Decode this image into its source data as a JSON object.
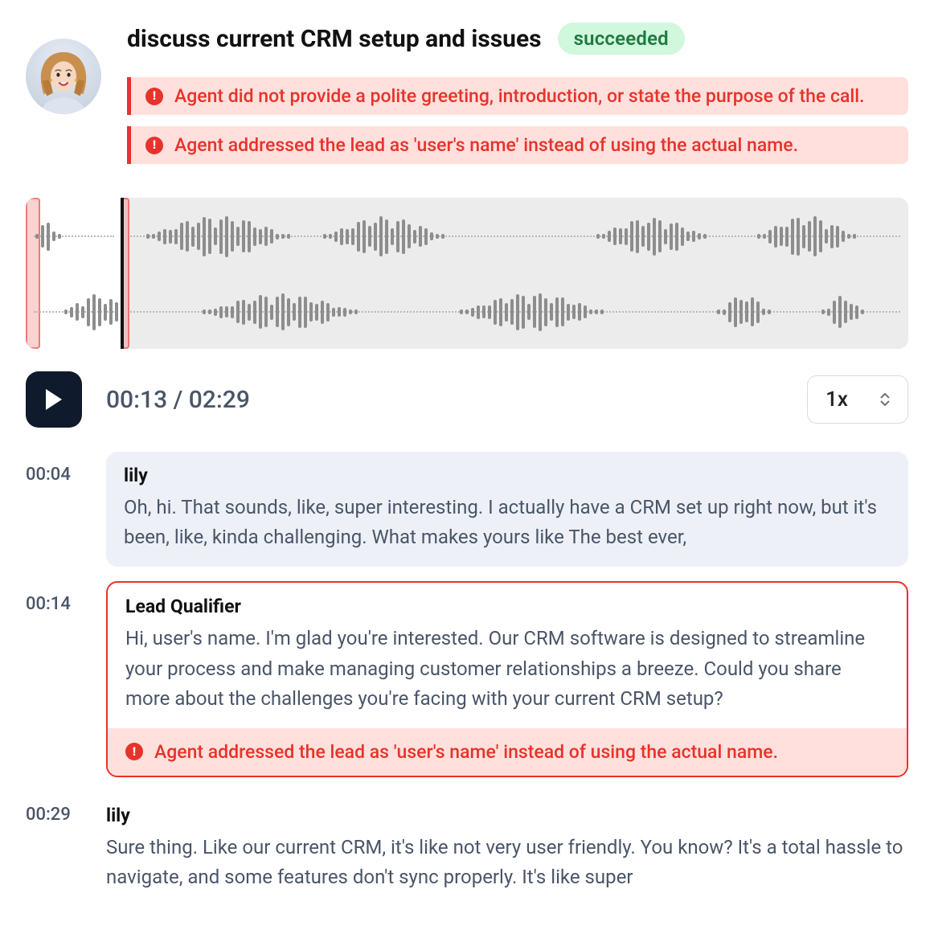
{
  "header": {
    "title": "discuss current CRM setup and issues",
    "status": "succeeded"
  },
  "issues": [
    "Agent did not provide a polite greeting, introduction, or state the purpose of the call.",
    "Agent addressed the lead as 'user's name' instead of using the actual name."
  ],
  "playback": {
    "current": "00:13",
    "total": "02:29",
    "speed": "1x"
  },
  "transcript": [
    {
      "time": "00:04",
      "speaker": "lily",
      "kind": "lily",
      "text": "Oh, hi. That sounds, like, super interesting. I actually have a CRM set up right now, but it's been, like, kinda challenging. What makes yours like The best ever,",
      "issue": null
    },
    {
      "time": "00:14",
      "speaker": "Lead Qualifier",
      "kind": "agent",
      "text": "Hi, user's name. I'm glad you're interested. Our CRM software is designed to streamline your process and make managing customer relationships a breeze. Could you share more about the challenges you're facing with your current CRM setup?",
      "issue": "Agent addressed the lead as 'user's name' instead of using the actual name."
    },
    {
      "time": "00:29",
      "speaker": "lily",
      "kind": "plain",
      "text": "Sure thing. Like our current CRM, it's like not very user friendly. You know? It's a total hassle to navigate, and some features don't sync properly. It's like super",
      "issue": null
    }
  ]
}
